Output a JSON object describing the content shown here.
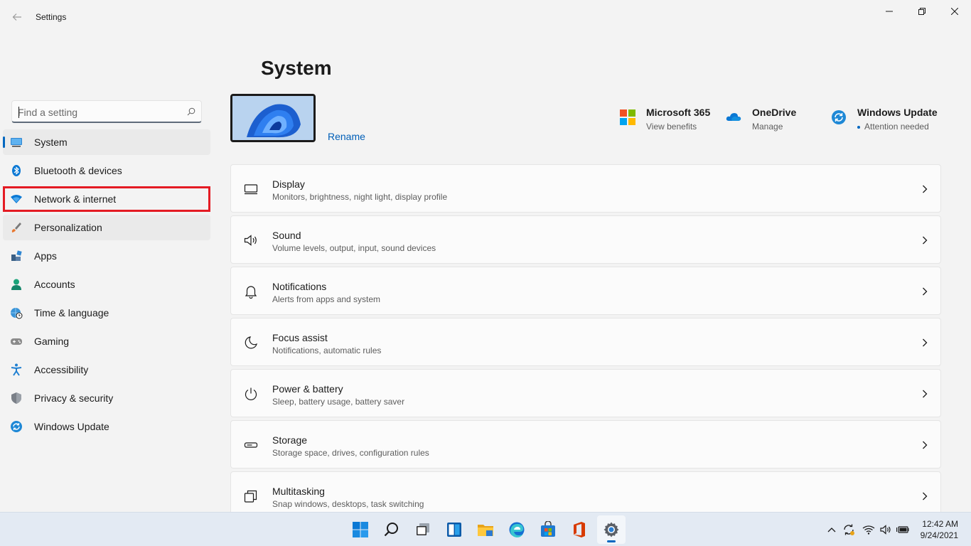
{
  "window": {
    "title": "Settings",
    "back_icon": "back-arrow-icon",
    "controls": [
      "minimize-icon",
      "maximize-icon",
      "close-icon"
    ]
  },
  "search": {
    "placeholder": "Find a setting",
    "value": ""
  },
  "sidebar": {
    "items": [
      {
        "label": "System",
        "icon": "monitor-icon",
        "selected": true
      },
      {
        "label": "Bluetooth & devices",
        "icon": "bluetooth-icon"
      },
      {
        "label": "Network & internet",
        "icon": "wifi-icon",
        "highlighted": true
      },
      {
        "label": "Personalization",
        "icon": "brush-icon",
        "hover": true
      },
      {
        "label": "Apps",
        "icon": "apps-icon"
      },
      {
        "label": "Accounts",
        "icon": "person-icon"
      },
      {
        "label": "Time & language",
        "icon": "globe-clock-icon"
      },
      {
        "label": "Gaming",
        "icon": "gamepad-icon"
      },
      {
        "label": "Accessibility",
        "icon": "accessibility-icon"
      },
      {
        "label": "Privacy & security",
        "icon": "shield-icon"
      },
      {
        "label": "Windows Update",
        "icon": "update-icon"
      }
    ]
  },
  "main": {
    "title": "System",
    "rename_label": "Rename",
    "promos": [
      {
        "title": "Microsoft 365",
        "subtitle": "View benefits",
        "icon": "microsoft-logo-icon"
      },
      {
        "title": "OneDrive",
        "subtitle": "Manage",
        "icon": "onedrive-cloud-icon"
      },
      {
        "title": "Windows Update",
        "subtitle": "Attention needed",
        "icon": "windows-update-icon"
      }
    ],
    "cards": [
      {
        "title": "Display",
        "subtitle": "Monitors, brightness, night light, display profile",
        "icon": "display-icon"
      },
      {
        "title": "Sound",
        "subtitle": "Volume levels, output, input, sound devices",
        "icon": "speaker-icon"
      },
      {
        "title": "Notifications",
        "subtitle": "Alerts from apps and system",
        "icon": "bell-icon"
      },
      {
        "title": "Focus assist",
        "subtitle": "Notifications, automatic rules",
        "icon": "moon-icon"
      },
      {
        "title": "Power & battery",
        "subtitle": "Sleep, battery usage, battery saver",
        "icon": "power-icon"
      },
      {
        "title": "Storage",
        "subtitle": "Storage space, drives, configuration rules",
        "icon": "storage-icon"
      },
      {
        "title": "Multitasking",
        "subtitle": "Snap windows, desktops, task switching",
        "icon": "multitasking-icon"
      }
    ]
  },
  "taskbar": {
    "apps": [
      "start-icon",
      "search-icon",
      "task-view-icon",
      "widgets-icon",
      "file-explorer-icon",
      "edge-icon",
      "store-icon",
      "office-icon",
      "settings-icon"
    ],
    "active_app": "settings-icon",
    "tray": [
      "chevron-up-icon",
      "sync-icon",
      "wifi-icon",
      "volume-icon",
      "battery-icon"
    ],
    "time": "12:42 AM",
    "date": "9/24/2021"
  },
  "colors": {
    "accent": "#0067c0",
    "highlight_box": "#e41b23",
    "background": "#f3f3f3"
  }
}
